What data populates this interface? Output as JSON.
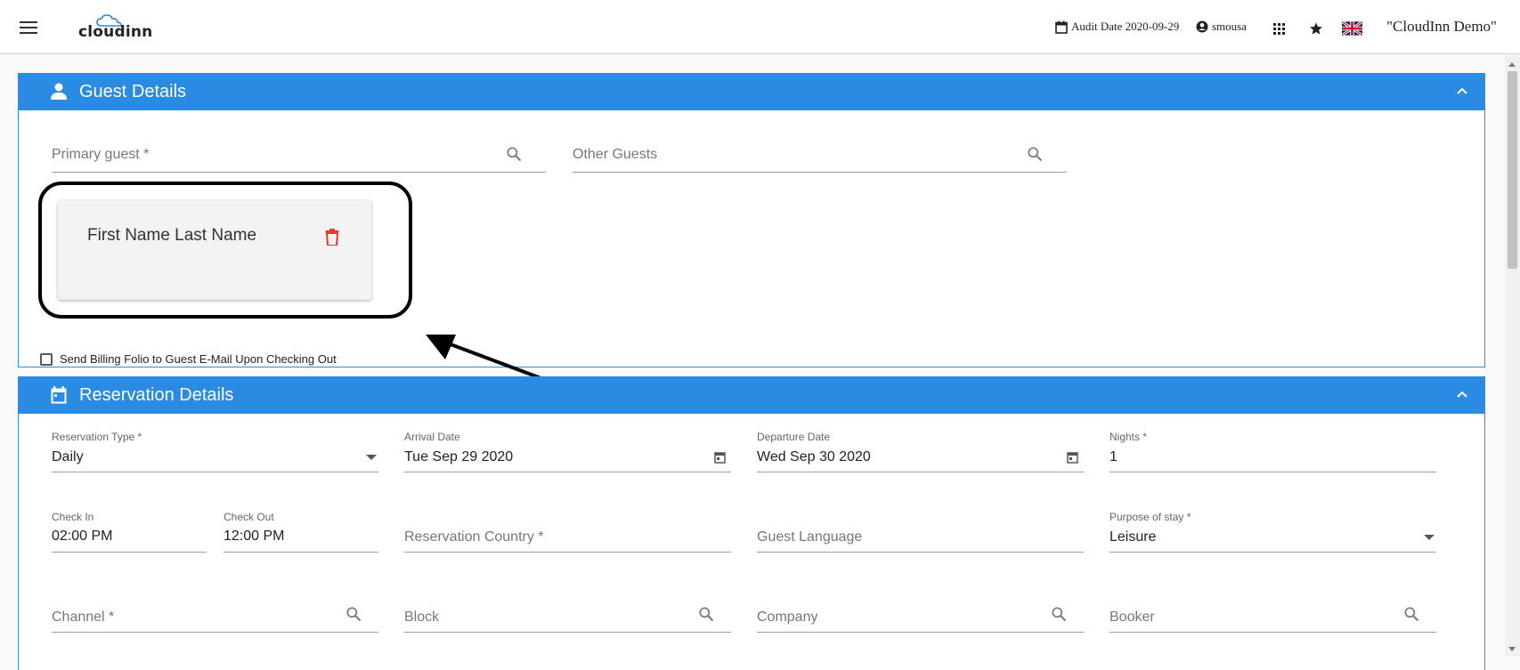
{
  "topbar": {
    "logo_text": "cloudinn",
    "audit_date": "Audit Date 2020-09-29",
    "username": "smousa",
    "company": "\"CloudInn Demo\""
  },
  "guest_details": {
    "title": "Guest Details",
    "primary_guest_placeholder": "Primary guest *",
    "other_guests_placeholder": "Other Guests",
    "guest_card_name": "First Name Last Name",
    "send_folio_label": "Send Billing Folio to Guest E-Mail Upon Checking Out"
  },
  "reservation_details": {
    "title": "Reservation Details",
    "reservation_type": {
      "label": "Reservation Type *",
      "value": "Daily"
    },
    "arrival_date": {
      "label": "Arrival Date",
      "value": "Tue Sep 29 2020"
    },
    "departure_date": {
      "label": "Departure Date",
      "value": "Wed Sep 30 2020"
    },
    "nights": {
      "label": "Nights *",
      "value": "1"
    },
    "check_in": {
      "label": "Check In",
      "value": "02:00 PM"
    },
    "check_out": {
      "label": "Check Out",
      "value": "12:00 PM"
    },
    "reservation_country_placeholder": "Reservation Country *",
    "guest_language_placeholder": "Guest Language",
    "purpose_of_stay": {
      "label": "Purpose of stay *",
      "value": "Leisure"
    },
    "channel_placeholder": "Channel *",
    "block_placeholder": "Block",
    "company_placeholder": "Company",
    "booker_placeholder": "Booker"
  },
  "colors": {
    "header_blue": "#2b8ae2",
    "delete_red": "#e53935"
  }
}
